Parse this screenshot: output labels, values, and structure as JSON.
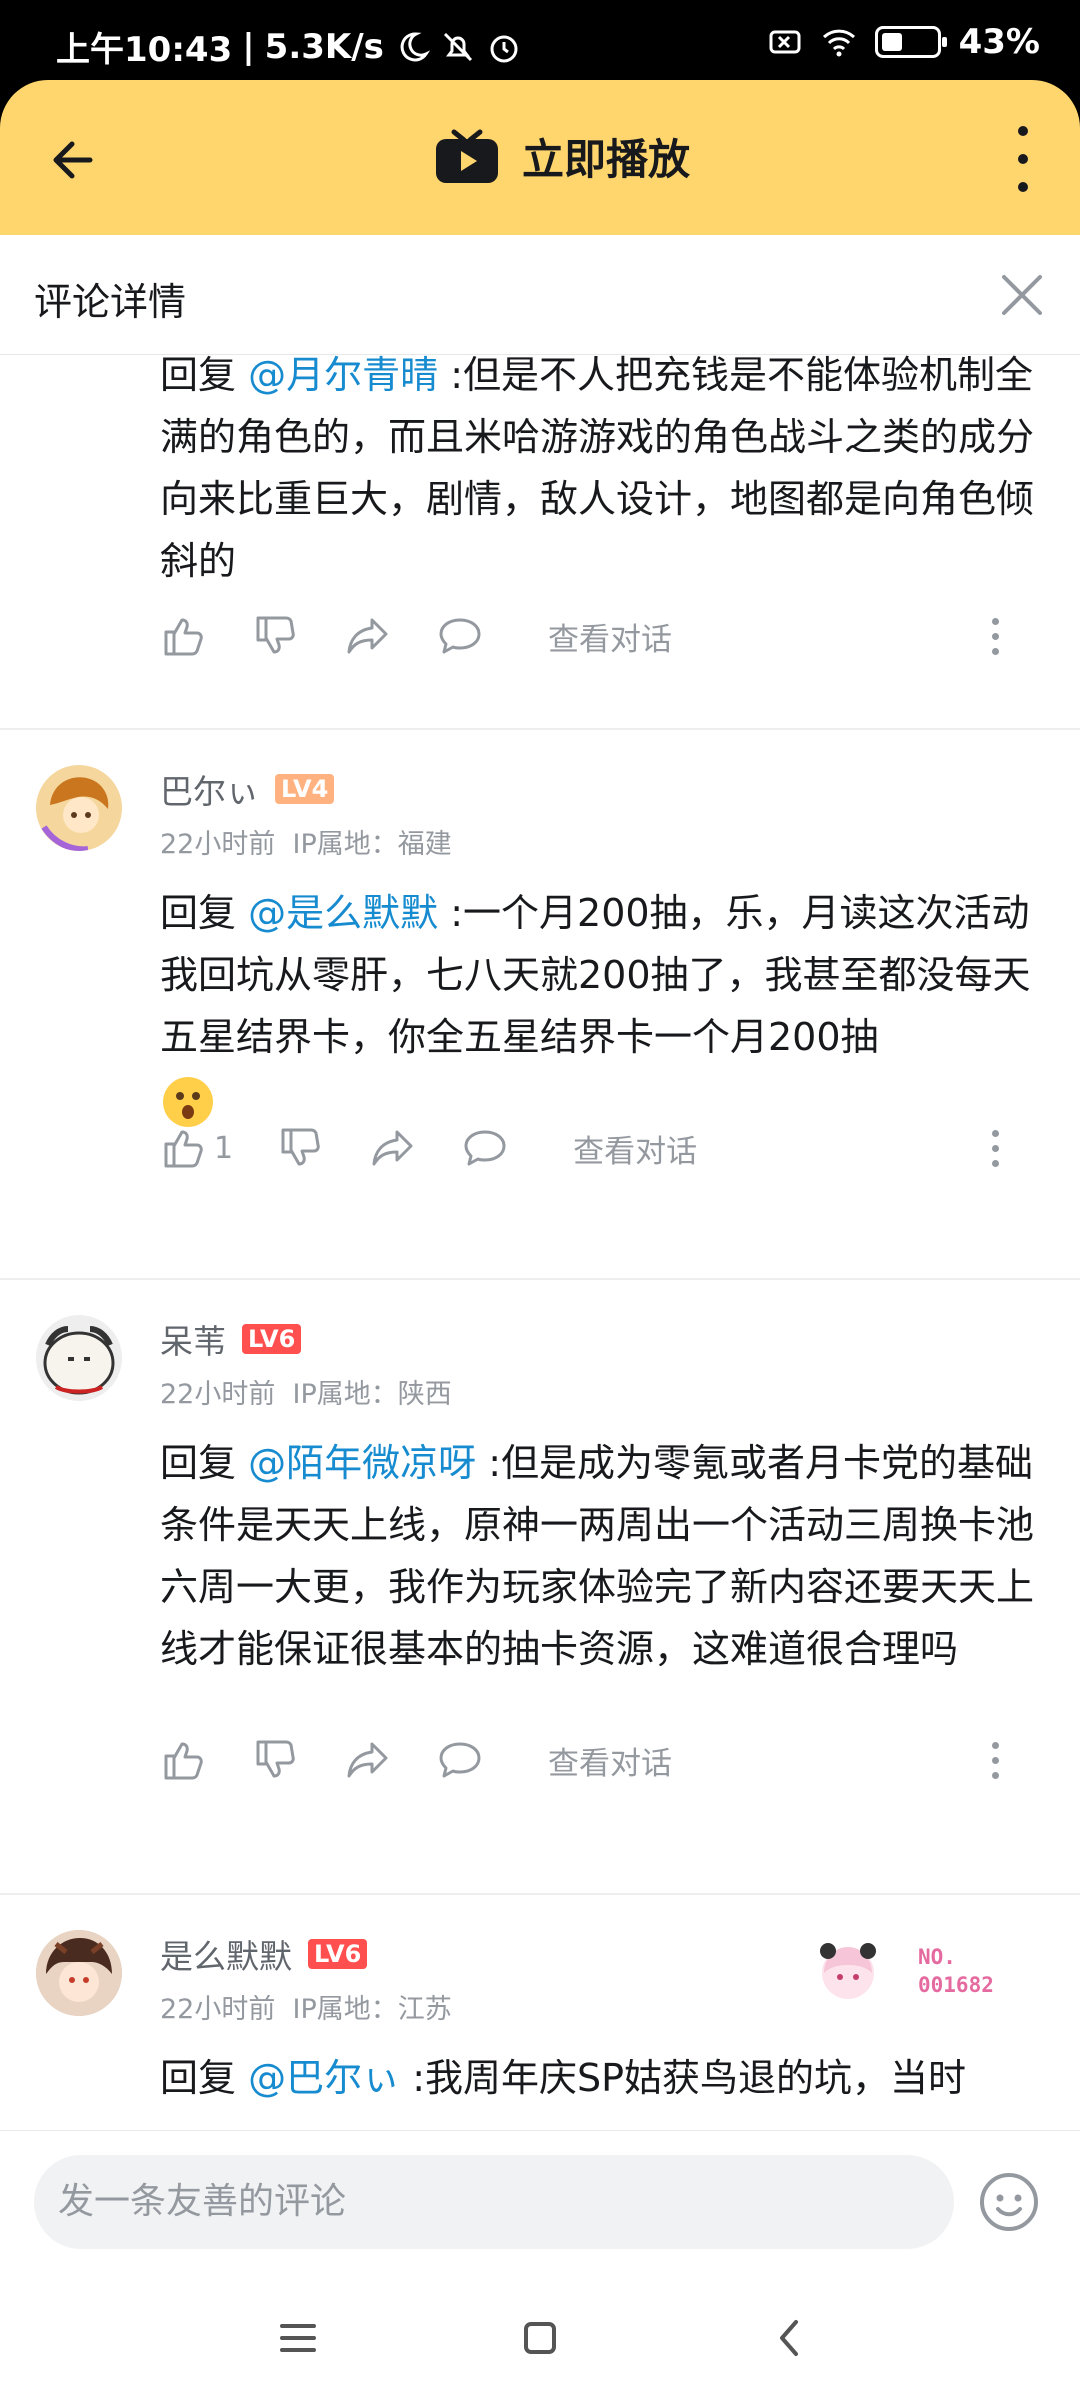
{
  "status_bar": {
    "time": "上午10:43",
    "speed": "5.3K/s",
    "battery": "43%"
  },
  "header": {
    "title": "立即播放"
  },
  "detail": {
    "label": "评论详情"
  },
  "comments": [
    {
      "reply_prefix": "回复",
      "mention": "@月尔青晴",
      "text": ":但是不人把充钱是不能体验机制全满的角色的，而且米哈游游戏的角色战斗之类的成分向来比重巨大，剧情，敌人设计，地图都是向角色倾斜的",
      "like_count": "",
      "view_conversation": "查看对话"
    },
    {
      "username": "巴尔ぃ",
      "level": "LV4",
      "time": "22小时前",
      "ip": "IP属地：福建",
      "reply_prefix": "回复",
      "mention": "@是么默默",
      "text": ":一个月200抽，乐，月读这次活动我回坑从零肝，七八天就200抽了，我甚至都没每天五星结界卡，你全五星结界卡一个月200抽",
      "like_count": "1",
      "view_conversation": "查看对话"
    },
    {
      "username": "呆苇",
      "level": "LV6",
      "time": "22小时前",
      "ip": "IP属地：陕西",
      "reply_prefix": "回复",
      "mention": "@陌年微凉呀",
      "text": ":但是成为零氪或者月卡党的基础条件是天天上线，原神一两周出一个活动三周换卡池六周一大更，我作为玩家体验完了新内容还要天天上线才能保证很基本的抽卡资源，这难道很合理吗",
      "like_count": "",
      "view_conversation": "查看对话"
    },
    {
      "username": "是么默默",
      "level": "LV6",
      "time": "22小时前",
      "ip": "IP属地：江苏",
      "badge_text": "NO.\n001682",
      "reply_prefix": "回复",
      "mention": "@巴尔ぃ",
      "text": ":我周年庆SP姑获鸟退的坑，当时"
    }
  ],
  "input": {
    "placeholder": "发一条友善的评论"
  },
  "colors": {
    "header_bg": "#ffd66e",
    "mention": "#178bcf",
    "lv4": "#ffb27f",
    "lv6": "#ff4f4f"
  }
}
